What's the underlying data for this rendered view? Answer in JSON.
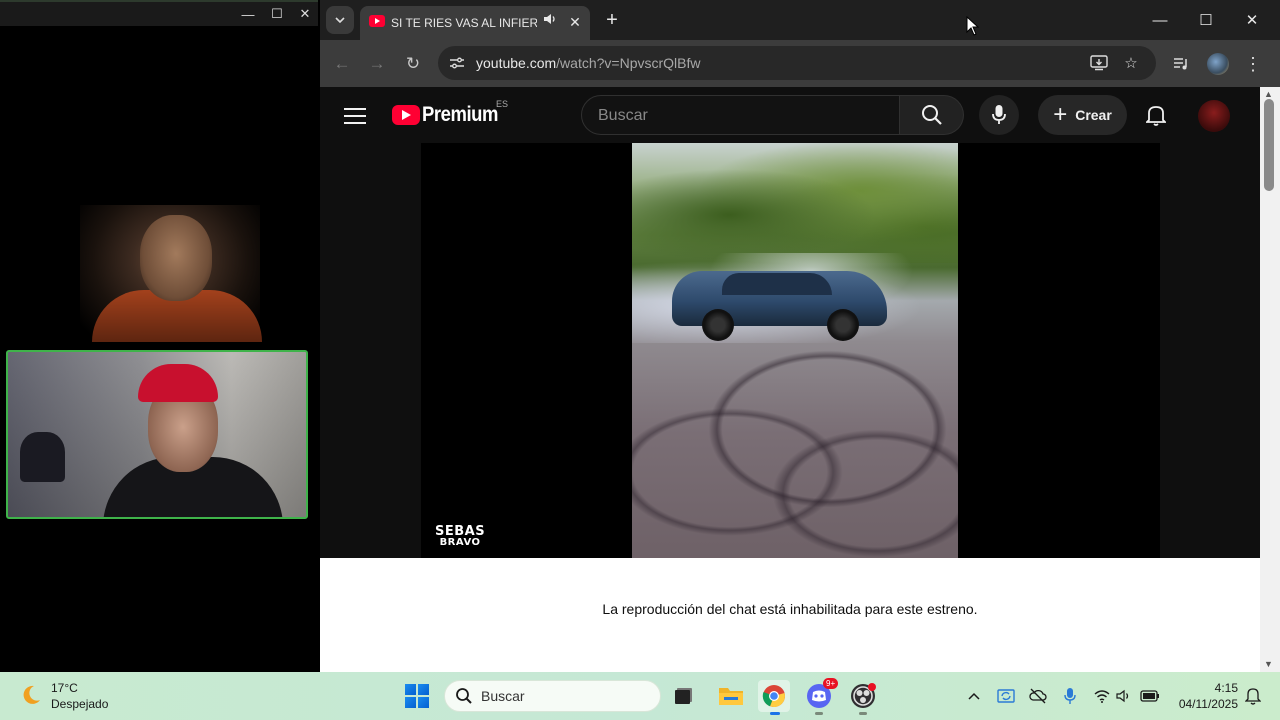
{
  "left_window": {
    "controls": {
      "minimize": "—",
      "maximize": "☐",
      "close": "✕"
    }
  },
  "browser": {
    "tab": {
      "title": "SI TE RIES VAS AL INFIERNO",
      "audio_icon": "speaker-icon",
      "close": "✕"
    },
    "new_tab": "+",
    "window_controls": {
      "minimize": "—",
      "maximize": "☐",
      "close": "✕"
    },
    "url_host": "youtube.com",
    "url_rest": "/watch?v=NpvscrQlBfw"
  },
  "youtube": {
    "logo_text": "Premium",
    "region": "ES",
    "search_placeholder": "Buscar",
    "create_label": "Crear",
    "video_watermark": "SEBAS",
    "video_watermark_sub": "BRAVO",
    "chat_message": "La reproducción del chat está inhabilitada para este estreno."
  },
  "taskbar": {
    "weather_temp": "17°C",
    "weather_desc": "Despejado",
    "search_text": "Buscar",
    "time": "4:15",
    "date": "04/11/2025",
    "discord_badge": "9+"
  },
  "colors": {
    "youtube_red": "#ff0033",
    "taskbar": "#c5e8d5",
    "active_call_border": "#3fb34a"
  }
}
